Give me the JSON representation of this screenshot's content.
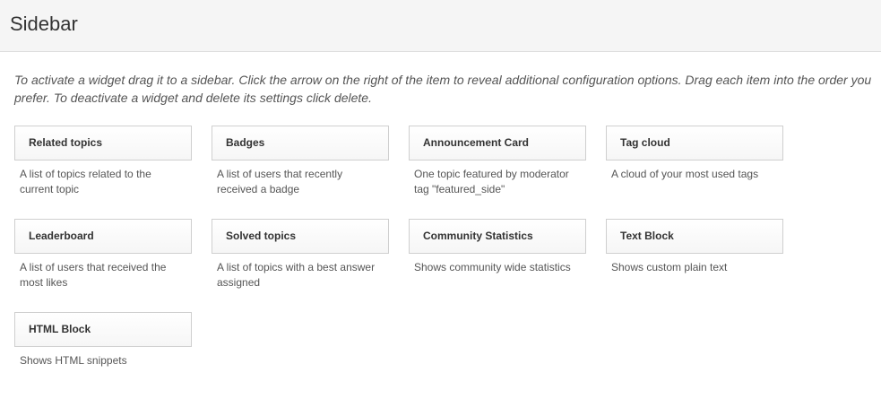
{
  "header": {
    "title": "Sidebar"
  },
  "intro": "To activate a widget drag it to a sidebar. Click the arrow on the right of the item to reveal additional configuration options. Drag each item into the order you prefer. To deactivate a widget and delete its settings click delete.",
  "widgets": [
    {
      "title": "Related topics",
      "description": "A list of topics related to the current topic"
    },
    {
      "title": "Badges",
      "description": "A list of users that recently received a badge"
    },
    {
      "title": "Announcement Card",
      "description": "One topic featured by moderator tag \"featured_side\""
    },
    {
      "title": "Tag cloud",
      "description": "A cloud of your most used tags"
    },
    {
      "title": "Leaderboard",
      "description": "A list of users that received the most likes"
    },
    {
      "title": "Solved topics",
      "description": "A list of topics with a best answer assigned"
    },
    {
      "title": "Community Statistics",
      "description": "Shows community wide statistics"
    },
    {
      "title": "Text Block",
      "description": "Shows custom plain text"
    },
    {
      "title": "HTML Block",
      "description": "Shows HTML snippets"
    }
  ]
}
